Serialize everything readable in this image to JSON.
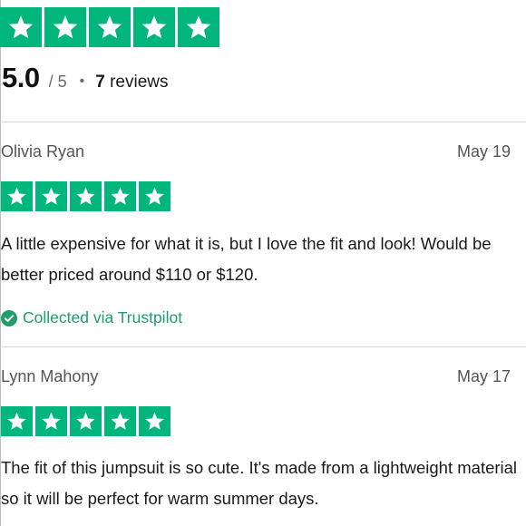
{
  "colors": {
    "star_green": "#00b67a",
    "collected_green": "#1f9d6a",
    "text_dark": "#1a1a1a",
    "text_muted": "#555555"
  },
  "summary": {
    "stars_filled": 5,
    "stars_total": 5,
    "score": "5.0",
    "out_of": "/ 5",
    "separator": "•",
    "review_count": "7",
    "review_count_label": "reviews"
  },
  "reviews": [
    {
      "reviewer": "Olivia Ryan",
      "date": "May 19",
      "rating": 5,
      "text": "A little expensive for what it is, but I love the fit and look! Would be better priced around $110 or $120.",
      "collected_label": "Collected via Trustpilot",
      "collected_icon": "check-circle-icon"
    },
    {
      "reviewer": "Lynn Mahony",
      "date": "May 17",
      "rating": 5,
      "text": "The fit of this jumpsuit is so cute. It's made from a lightweight material so it will be perfect for warm summer days."
    }
  ]
}
